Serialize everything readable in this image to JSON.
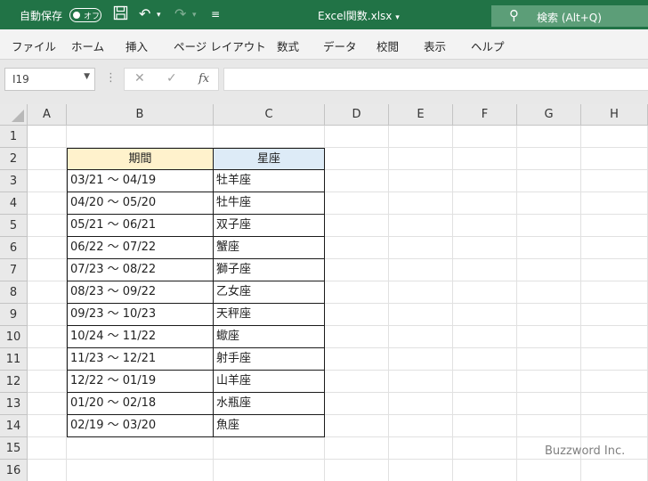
{
  "titlebar": {
    "autosave_label": "自動保存",
    "autosave_state": "オフ",
    "file_name": "Excel関数.xlsx",
    "file_dropdown": "▾",
    "search_placeholder": "検索 (Alt+Q)"
  },
  "ribbon_tabs": [
    "ファイル",
    "ホーム",
    "挿入",
    "ページ レイアウト",
    "数式",
    "データ",
    "校閲",
    "表示",
    "ヘルプ"
  ],
  "formula_bar": {
    "name_box": "I19",
    "formula": ""
  },
  "sheet": {
    "columns": [
      "A",
      "B",
      "C",
      "D",
      "E",
      "F",
      "G",
      "H"
    ],
    "rows": [
      "1",
      "2",
      "3",
      "4",
      "5",
      "6",
      "7",
      "8",
      "9",
      "10",
      "11",
      "12",
      "13",
      "14",
      "15",
      "16"
    ],
    "header_period": "期間",
    "header_sign": "星座",
    "table": [
      {
        "period": "03/21 ～ 04/19",
        "sign": "牡羊座"
      },
      {
        "period": "04/20 ～ 05/20",
        "sign": "牡牛座"
      },
      {
        "period": "05/21 ～ 06/21",
        "sign": "双子座"
      },
      {
        "period": "06/22 ～ 07/22",
        "sign": "蟹座"
      },
      {
        "period": "07/23 ～ 08/22",
        "sign": "獅子座"
      },
      {
        "period": "08/23 ～ 09/22",
        "sign": "乙女座"
      },
      {
        "period": "09/23 ～ 10/23",
        "sign": "天秤座"
      },
      {
        "period": "10/24 ～ 11/22",
        "sign": "蠍座"
      },
      {
        "period": "11/23 ～ 12/21",
        "sign": "射手座"
      },
      {
        "period": "12/22 ～ 01/19",
        "sign": "山羊座"
      },
      {
        "period": "01/20 ～ 02/18",
        "sign": "水瓶座"
      },
      {
        "period": "02/19 ～ 03/20",
        "sign": "魚座"
      }
    ]
  },
  "watermark": "Buzzword Inc.",
  "colors": {
    "excel_green": "#217346",
    "header_period_fill": "#fff2cc",
    "header_sign_fill": "#ddebf7"
  }
}
